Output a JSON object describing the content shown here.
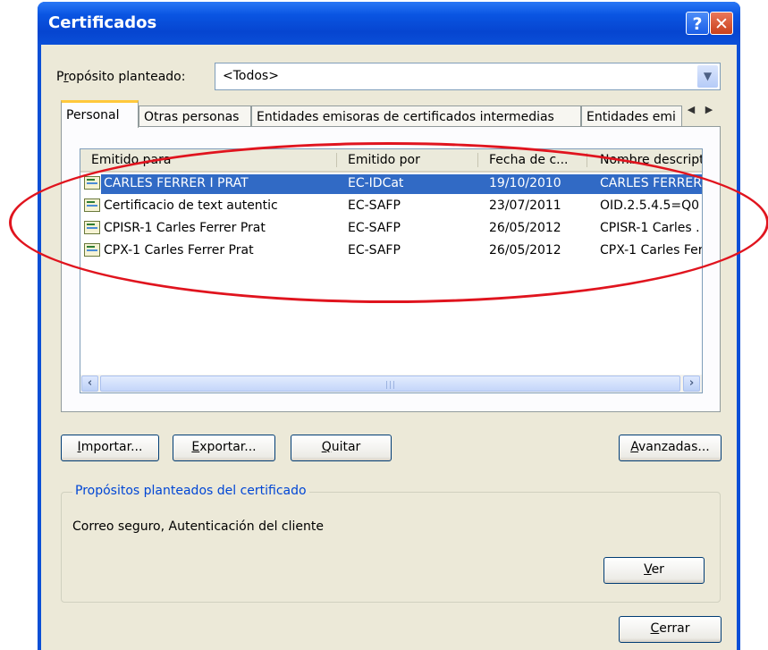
{
  "window": {
    "title": "Certificados",
    "help_label": "?",
    "close_label": "✕"
  },
  "purpose": {
    "label_prefix": "P",
    "label_accel": "r",
    "label_rest": "opósito planteado:",
    "value": "<Todos>"
  },
  "tabs": [
    {
      "label": "Personal"
    },
    {
      "label": "Otras personas"
    },
    {
      "label": "Entidades emisoras de certificados intermedias"
    },
    {
      "label": "Entidades emi"
    }
  ],
  "list": {
    "columns": [
      "Emitido para",
      "Emitido por",
      "Fecha de c...",
      "Nombre descripti"
    ],
    "rows": [
      {
        "issued_to": "CARLES FERRER I PRAT",
        "issued_by": "EC-IDCat",
        "date": "19/10/2010",
        "friendly": "CARLES FERRER",
        "selected": true
      },
      {
        "issued_to": "Certificacio de text autentic",
        "issued_by": "EC-SAFP",
        "date": "23/07/2011",
        "friendly": "OID.2.5.4.5=Q0"
      },
      {
        "issued_to": "CPISR-1 Carles Ferrer Prat",
        "issued_by": "EC-SAFP",
        "date": "26/05/2012",
        "friendly": "CPISR-1 Carles ."
      },
      {
        "issued_to": "CPX-1 Carles Ferrer Prat",
        "issued_by": "EC-SAFP",
        "date": "26/05/2012",
        "friendly": "CPX-1 Carles Fer"
      }
    ]
  },
  "buttons": {
    "import": {
      "accel": "I",
      "rest": "mportar..."
    },
    "export": {
      "accel": "E",
      "rest": "xportar..."
    },
    "remove": {
      "accel": "Q",
      "rest": "uitar"
    },
    "advanced": {
      "accel": "A",
      "rest": "vanzadas..."
    },
    "view": {
      "accel": "V",
      "rest": "er"
    },
    "close": {
      "accel": "C",
      "rest": "errar"
    }
  },
  "purposes_group": {
    "title": "Propósitos planteados del certificado",
    "text": "Correo seguro, Autenticación del cliente"
  },
  "colors": {
    "title_bar": "#0a55e2",
    "selection": "#316ac5",
    "highlight_circle": "#e0141e",
    "group_title": "#0046d5"
  }
}
